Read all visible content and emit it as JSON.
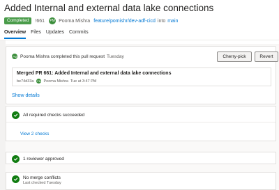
{
  "pr": {
    "title": "Added Internal and external data lake connections",
    "status_badge": "Completed",
    "number": "!661",
    "author_initials": "PM",
    "author": "Pooma Mishra",
    "source_branch": "feature/pomishr/dev-adf-cicd",
    "into_text": "into",
    "target_branch": "main"
  },
  "tabs": [
    "Overview",
    "Files",
    "Updates",
    "Commits"
  ],
  "completion": {
    "author_initials": "PM",
    "text": "Pooma Mishra completed this pull request",
    "when": "Tuesday",
    "cherry_pick_label": "Cherry-pick",
    "revert_label": "Revert",
    "merge_title": "Merged PR 661: Added Internal and external data lake connections",
    "commit_id": "be74d33a",
    "merge_author_initials": "PM",
    "merge_author": "Pooma Mishra",
    "merge_time": "Tue at 3:47 PM",
    "show_details_label": "Show details"
  },
  "checks": {
    "summary": "All required checks succeeded",
    "view_label": "View 2 checks"
  },
  "reviewers": {
    "summary": "1 reviewer approved"
  },
  "conflicts": {
    "summary": "No merge conflicts",
    "last_checked": "Last checked Tuesday"
  },
  "colors": {
    "accent": "#0078d4",
    "success": "#107c10",
    "badge": "#4a9c4a"
  }
}
